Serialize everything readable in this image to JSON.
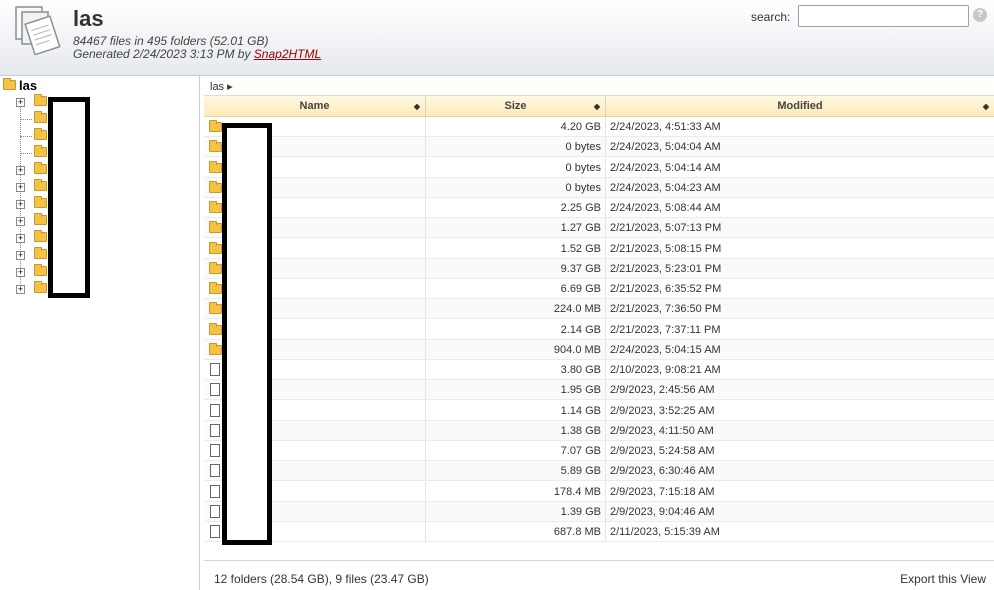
{
  "header": {
    "title": "las",
    "stats": "84467 files in 495 folders (52.01 GB)",
    "generated_prefix": "Generated 2/24/2023 3:13 PM by ",
    "generator_link": "Snap2HTML",
    "search_label": "search:",
    "search_value": "",
    "help_glyph": "?"
  },
  "tree": {
    "root_label": "las",
    "items": [
      {
        "expandable": true
      },
      {
        "expandable": false
      },
      {
        "expandable": false
      },
      {
        "expandable": false
      },
      {
        "expandable": true
      },
      {
        "expandable": true
      },
      {
        "expandable": true
      },
      {
        "expandable": true
      },
      {
        "expandable": true
      },
      {
        "expandable": true
      },
      {
        "expandable": true
      },
      {
        "expandable": true
      }
    ]
  },
  "breadcrumb": "las ▸",
  "columns": {
    "name": "Name",
    "size": "Size",
    "modified": "Modified",
    "sort_glyph": "◆"
  },
  "rows": [
    {
      "type": "folder",
      "size": "4.20 GB",
      "modified": "2/24/2023, 4:51:33 AM"
    },
    {
      "type": "folder",
      "size": "0 bytes",
      "modified": "2/24/2023, 5:04:04 AM"
    },
    {
      "type": "folder",
      "size": "0 bytes",
      "modified": "2/24/2023, 5:04:14 AM"
    },
    {
      "type": "folder",
      "size": "0 bytes",
      "modified": "2/24/2023, 5:04:23 AM"
    },
    {
      "type": "folder",
      "size": "2.25 GB",
      "modified": "2/24/2023, 5:08:44 AM"
    },
    {
      "type": "folder",
      "size": "1.27 GB",
      "modified": "2/21/2023, 5:07:13 PM"
    },
    {
      "type": "folder",
      "size": "1.52 GB",
      "modified": "2/21/2023, 5:08:15 PM"
    },
    {
      "type": "folder",
      "size": "9.37 GB",
      "modified": "2/21/2023, 5:23:01 PM"
    },
    {
      "type": "folder",
      "size": "6.69 GB",
      "modified": "2/21/2023, 6:35:52 PM"
    },
    {
      "type": "folder",
      "size": "224.0 MB",
      "modified": "2/21/2023, 7:36:50 PM"
    },
    {
      "type": "folder",
      "size": "2.14 GB",
      "modified": "2/21/2023, 7:37:11 PM"
    },
    {
      "type": "folder",
      "size": "904.0 MB",
      "modified": "2/24/2023, 5:04:15 AM"
    },
    {
      "type": "file",
      "size": "3.80 GB",
      "modified": "2/10/2023, 9:08:21 AM"
    },
    {
      "type": "file",
      "size": "1.95 GB",
      "modified": "2/9/2023, 2:45:56 AM"
    },
    {
      "type": "file",
      "size": "1.14 GB",
      "modified": "2/9/2023, 3:52:25 AM"
    },
    {
      "type": "file",
      "size": "1.38 GB",
      "modified": "2/9/2023, 4:11:50 AM"
    },
    {
      "type": "file",
      "size": "7.07 GB",
      "modified": "2/9/2023, 5:24:58 AM"
    },
    {
      "type": "file",
      "size": "5.89 GB",
      "modified": "2/9/2023, 6:30:46 AM"
    },
    {
      "type": "file",
      "size": "178.4 MB",
      "modified": "2/9/2023, 7:15:18 AM"
    },
    {
      "type": "file",
      "size": "1.39 GB",
      "modified": "2/9/2023, 9:04:46 AM"
    },
    {
      "type": "file",
      "size": "687.8 MB",
      "modified": "2/11/2023, 5:15:39 AM"
    }
  ],
  "footer": {
    "summary": "12 folders (28.54 GB), 9 files (23.47 GB)",
    "export_label": "Export this View"
  }
}
